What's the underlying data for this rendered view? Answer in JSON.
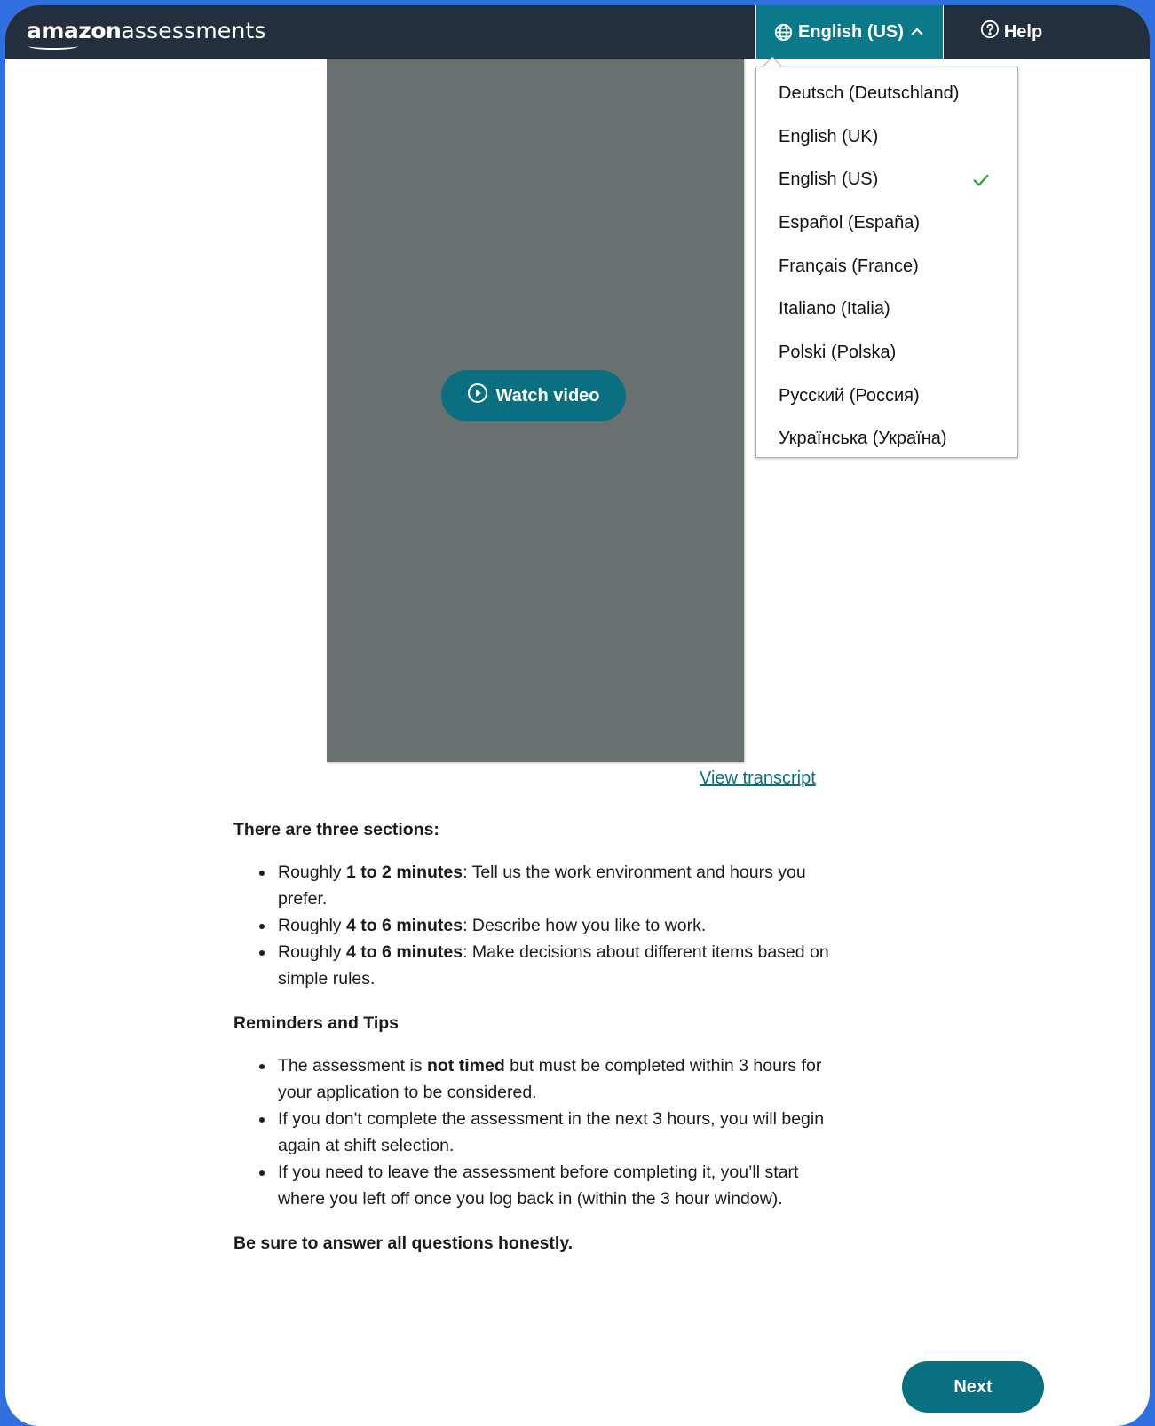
{
  "header": {
    "logo_brand": "amazon",
    "logo_product": "assessments",
    "language_button_label": "English (US)",
    "help_label": "Help"
  },
  "language_menu": {
    "selected": "English (US)",
    "items": [
      "Deutsch (Deutschland)",
      "English (UK)",
      "English (US)",
      "Español (España)",
      "Français (France)",
      "Italiano (Italia)",
      "Polski (Polska)",
      "Русский (Россия)",
      "Українська (Україна)"
    ]
  },
  "video": {
    "watch_label": "Watch video",
    "transcript_label": "View transcript"
  },
  "sections": {
    "heading": "There are three sections:",
    "items": [
      {
        "pre": "Roughly ",
        "bold": "1 to 2 minutes",
        "post": ": Tell us the work environment and hours you prefer."
      },
      {
        "pre": "Roughly ",
        "bold": "4 to 6 minutes",
        "post": ": Describe how you like to work."
      },
      {
        "pre": "Roughly ",
        "bold": "4 to 6 minutes",
        "post": ": Make decisions about different items based on simple rules."
      }
    ]
  },
  "reminders": {
    "heading": "Reminders and Tips",
    "items": [
      {
        "pre": "The assessment is ",
        "bold": "not timed",
        "post": " but must be completed within 3 hours for your application to be considered."
      },
      {
        "pre": "If you don't complete the assessment in the next 3 hours, you will begin again at shift selection.",
        "bold": "",
        "post": ""
      },
      {
        "pre": "If you need to leave the assessment before completing it, you’ll start where you left off once you log back in (within the 3 hour window).",
        "bold": "",
        "post": ""
      }
    ]
  },
  "closing_note": "Be sure to answer all questions honestly.",
  "next_label": "Next",
  "colors": {
    "header_bg": "#232f3e",
    "accent_teal": "#0a6f80",
    "video_bg": "#687170",
    "check_green": "#2e9e3e"
  },
  "icons": {
    "language": "globe-icon",
    "language_caret": "chevron-up-icon",
    "help": "help-circle-icon",
    "video": "play-circle-icon",
    "selected_language": "check-icon"
  }
}
